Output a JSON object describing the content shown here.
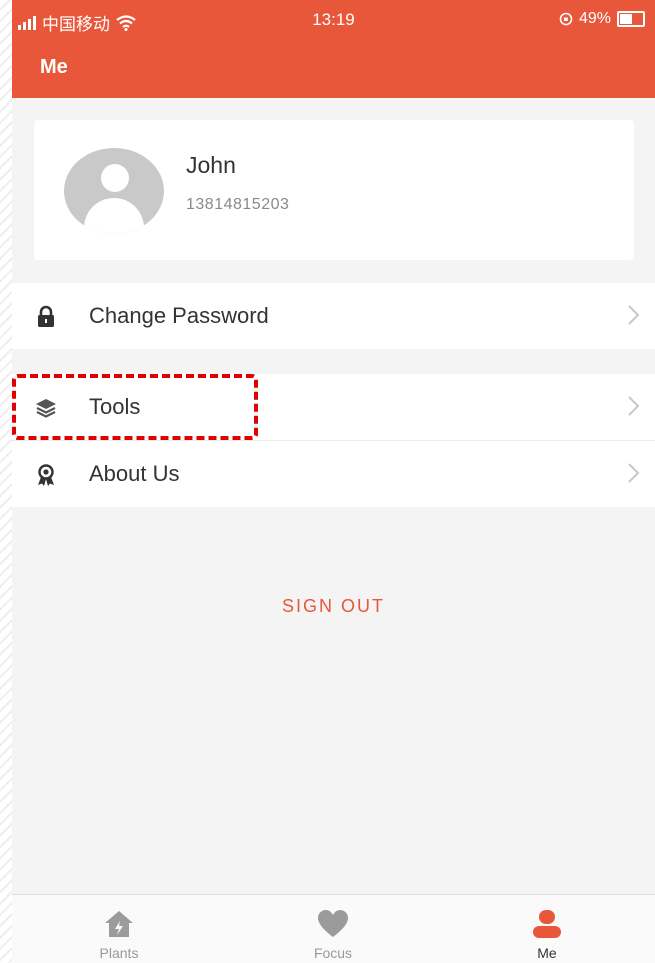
{
  "status_bar": {
    "carrier": "中国移动",
    "time": "13:19",
    "battery": "49%",
    "battery_level": 0.49
  },
  "header": {
    "title": "Me"
  },
  "profile": {
    "name": "John",
    "phone": "13814815203"
  },
  "menu": {
    "change_password": "Change Password",
    "tools": "Tools",
    "about_us": "About Us"
  },
  "sign_out_label": "SIGN OUT",
  "tabs": {
    "plants": "Plants",
    "focus": "Focus",
    "me": "Me"
  },
  "colors": {
    "accent": "#e8573a",
    "highlight": "#e00000",
    "inactive_icon": "#9b9b9b"
  },
  "icons": {
    "lock": "lock-icon",
    "layers": "layers-icon",
    "badge": "badge-icon",
    "chevron": "chevron-right-icon",
    "home": "home-icon",
    "heart": "heart-icon",
    "user": "user-icon"
  }
}
